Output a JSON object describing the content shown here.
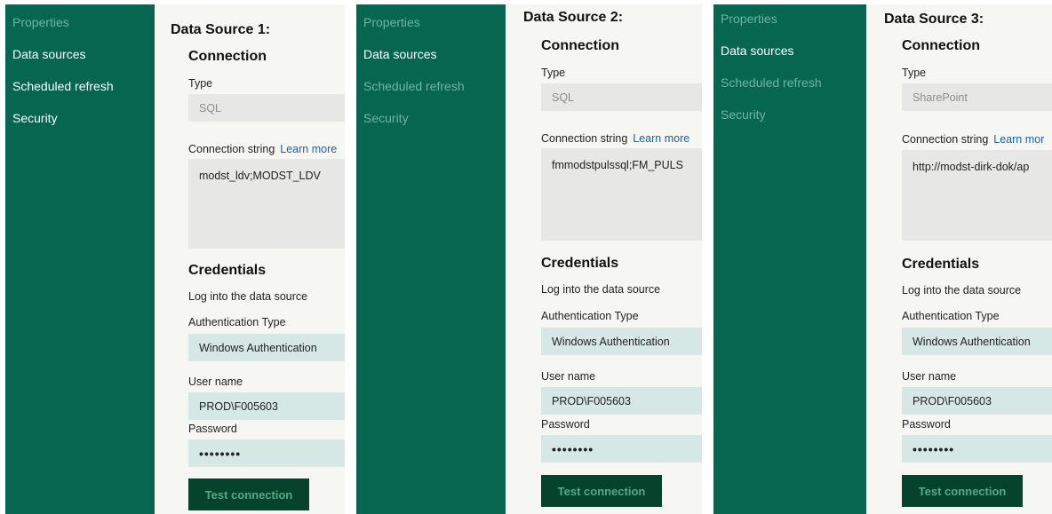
{
  "nav": {
    "properties": "Properties",
    "data_sources": "Data sources",
    "scheduled_refresh": "Scheduled refresh",
    "security": "Security"
  },
  "labels": {
    "connection": "Connection",
    "type": "Type",
    "connection_string": "Connection string",
    "learn_more": "Learn more",
    "learn_more_cut": "Learn mor",
    "credentials": "Credentials",
    "login_hint": "Log into the data source",
    "auth_type": "Authentication Type",
    "user_name": "User name",
    "password": "Password",
    "test_connection": "Test connection"
  },
  "sources": [
    {
      "title": "Data Source 1:",
      "type": "SQL",
      "connection_string": "modst_ldv;MODST_LDV",
      "auth": "Windows Authentication",
      "user": "PROD\\F005603",
      "password_mask": "••••••••"
    },
    {
      "title": "Data Source 2:",
      "type": "SQL",
      "connection_string": "fmmodstpulssql;FM_PULS",
      "auth": "Windows Authentication",
      "user": "PROD\\F005603",
      "password_mask": "••••••••"
    },
    {
      "title": "Data Source 3:",
      "type": "SharePoint",
      "connection_string": "http://modst-dirk-dok/ap",
      "auth": "Windows Authentication",
      "user": "PROD\\F005603",
      "password_mask": "••••••••"
    }
  ],
  "colors": {
    "sidebar": "#06664f",
    "button": "#05432c",
    "field_blue": "#d5e8e5",
    "link": "#1f5fa8"
  }
}
